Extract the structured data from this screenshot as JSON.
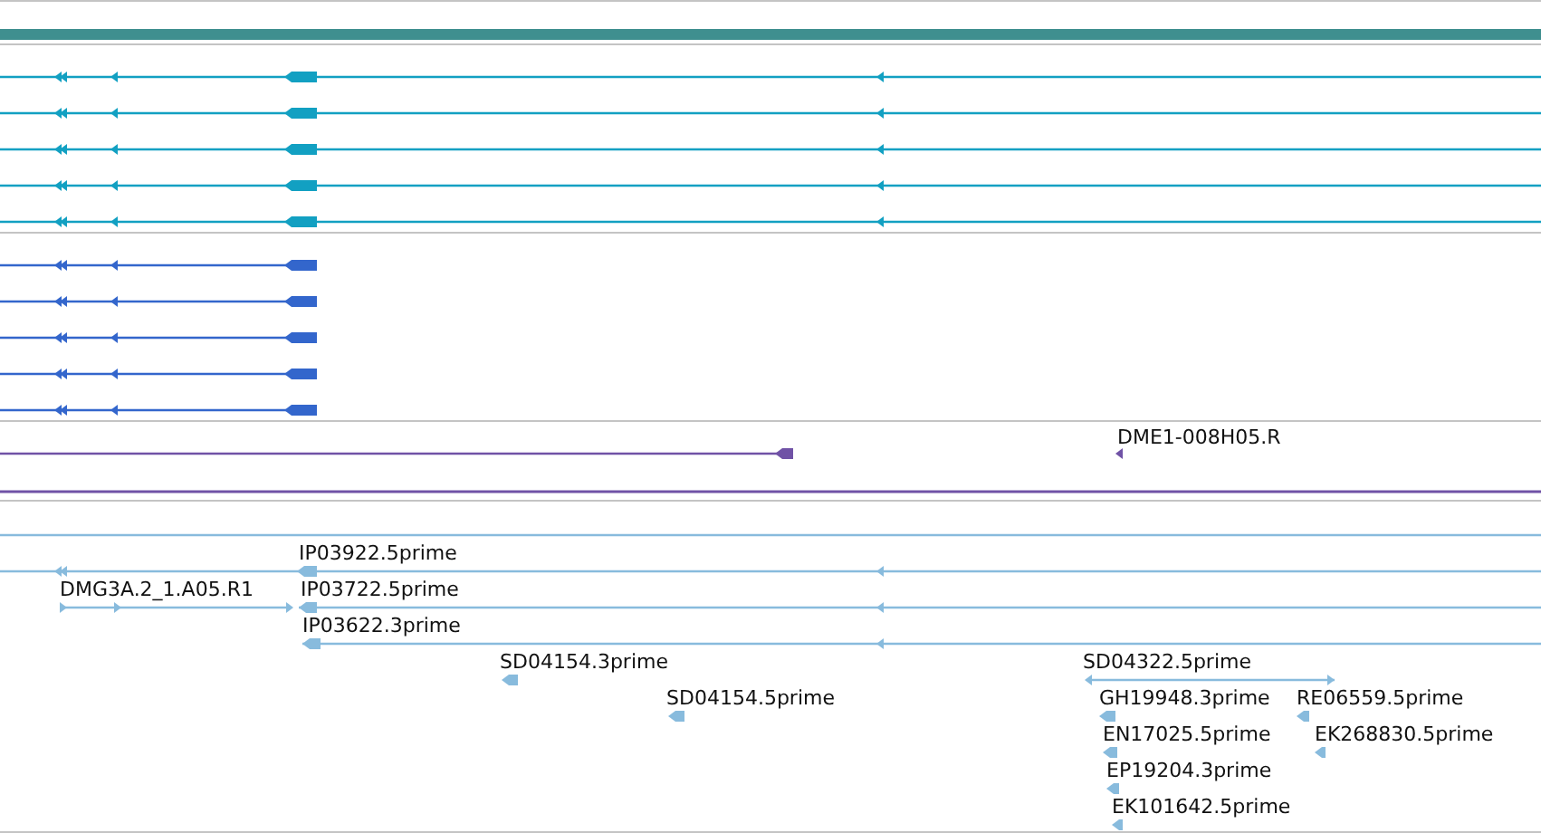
{
  "tracks": [
    {
      "kind": "ruler_bar",
      "color": "#3f8f8f"
    },
    {
      "kind": "gene_models",
      "color": "#12a0c2",
      "features": [
        {
          "kind": "transcript"
        },
        {
          "kind": "transcript"
        },
        {
          "kind": "transcript"
        },
        {
          "kind": "transcript"
        },
        {
          "kind": "transcript"
        }
      ]
    },
    {
      "kind": "gene_models",
      "color": "#3366cc",
      "features": [
        {
          "kind": "transcript"
        },
        {
          "kind": "transcript"
        },
        {
          "kind": "transcript"
        },
        {
          "kind": "transcript"
        },
        {
          "kind": "transcript"
        }
      ]
    },
    {
      "kind": "features",
      "color": "#7052a6",
      "features": [
        {
          "kind": "unlabeled"
        },
        {
          "kind": "labeled",
          "label": "DME1-008H05.R"
        }
      ]
    },
    {
      "kind": "features",
      "color": "#88bbdd",
      "features": [
        {
          "kind": "labeled",
          "label": "IP03922.5prime"
        },
        {
          "kind": "labeled",
          "label": "DMG3A.2_1.A05.R1"
        },
        {
          "kind": "labeled",
          "label": "IP03722.5prime"
        },
        {
          "kind": "labeled",
          "label": "IP03622.3prime"
        },
        {
          "kind": "labeled",
          "label": "SD04154.3prime"
        },
        {
          "kind": "labeled",
          "label": "SD04322.5prime"
        },
        {
          "kind": "labeled",
          "label": "SD04154.5prime"
        },
        {
          "kind": "labeled",
          "label": "GH19948.3prime"
        },
        {
          "kind": "labeled",
          "label": "RE06559.5prime"
        },
        {
          "kind": "labeled",
          "label": "EN17025.5prime"
        },
        {
          "kind": "labeled",
          "label": "EK268830.5prime"
        },
        {
          "kind": "labeled",
          "label": "EP19204.3prime"
        },
        {
          "kind": "labeled",
          "label": "EK101642.5prime"
        }
      ]
    }
  ]
}
